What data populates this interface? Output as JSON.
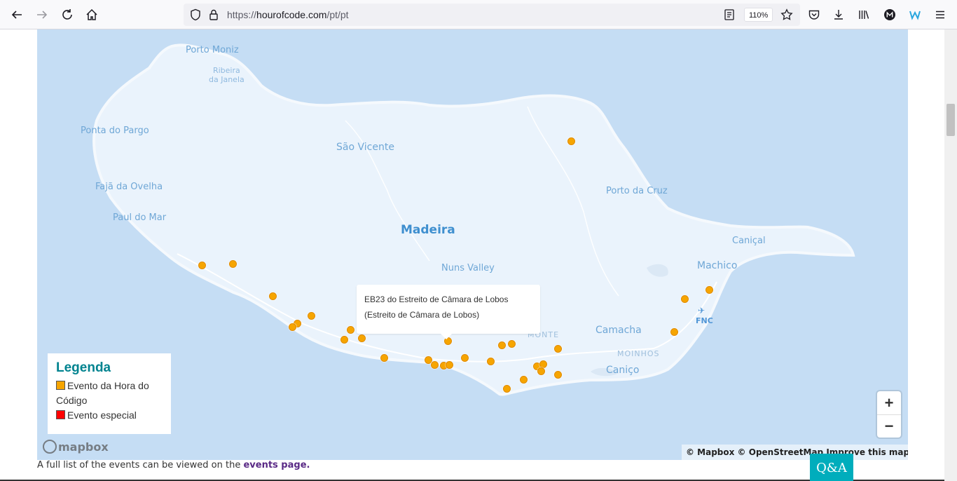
{
  "browser": {
    "url_scheme": "https://",
    "url_host": "hourofcode.com",
    "url_path": "/pt/pt",
    "zoom_level": "110%"
  },
  "map": {
    "places": [
      {
        "id": "porto-moniz",
        "label": "Porto Moniz",
        "kind": "town"
      },
      {
        "id": "ribeira-da-janela",
        "label": "Ribeira\nda Janela",
        "kind": "small"
      },
      {
        "id": "ponta-do-pargo",
        "label": "Ponta do Pargo",
        "kind": "town"
      },
      {
        "id": "sao-vicente",
        "label": "São Vicente",
        "kind": "town"
      },
      {
        "id": "faja-da-ovelha",
        "label": "Fajã da Ovelha",
        "kind": "town"
      },
      {
        "id": "paul-do-mar",
        "label": "Paul do Mar",
        "kind": "town"
      },
      {
        "id": "madeira",
        "label": "Madeira",
        "kind": "title"
      },
      {
        "id": "porto-da-cruz",
        "label": "Porto da Cruz",
        "kind": "town"
      },
      {
        "id": "canical",
        "label": "Caniçal",
        "kind": "town"
      },
      {
        "id": "machico",
        "label": "Machico",
        "kind": "town"
      },
      {
        "id": "nuns-valley",
        "label": "Nuns Valley",
        "kind": "town"
      },
      {
        "id": "monte",
        "label": "MONTE",
        "kind": "district"
      },
      {
        "id": "camacha",
        "label": "Camacha",
        "kind": "town"
      },
      {
        "id": "moinhos",
        "label": "MOINHOS",
        "kind": "district"
      },
      {
        "id": "canico",
        "label": "Caniço",
        "kind": "town"
      },
      {
        "id": "fnc",
        "label": "FNC",
        "kind": "airport"
      }
    ],
    "popup": {
      "line1": "EB23 do Estreito de Câmara de Lobos",
      "line2": "(Estreito de Câmara de Lobos)"
    },
    "legend": {
      "title": "Legenda",
      "items": [
        {
          "label": "Evento da Hora do Código",
          "color": "#f6a500"
        },
        {
          "label": "Evento especial",
          "color": "#ff0000"
        }
      ]
    },
    "zoom_in": "+",
    "zoom_out": "−",
    "attribution": "© Mapbox © OpenStreetMap Improve this map",
    "logo": "mapbox"
  },
  "footer": {
    "text": "A full list of the events can be viewed on the ",
    "link": "events page."
  },
  "qa_button": "Q&A"
}
